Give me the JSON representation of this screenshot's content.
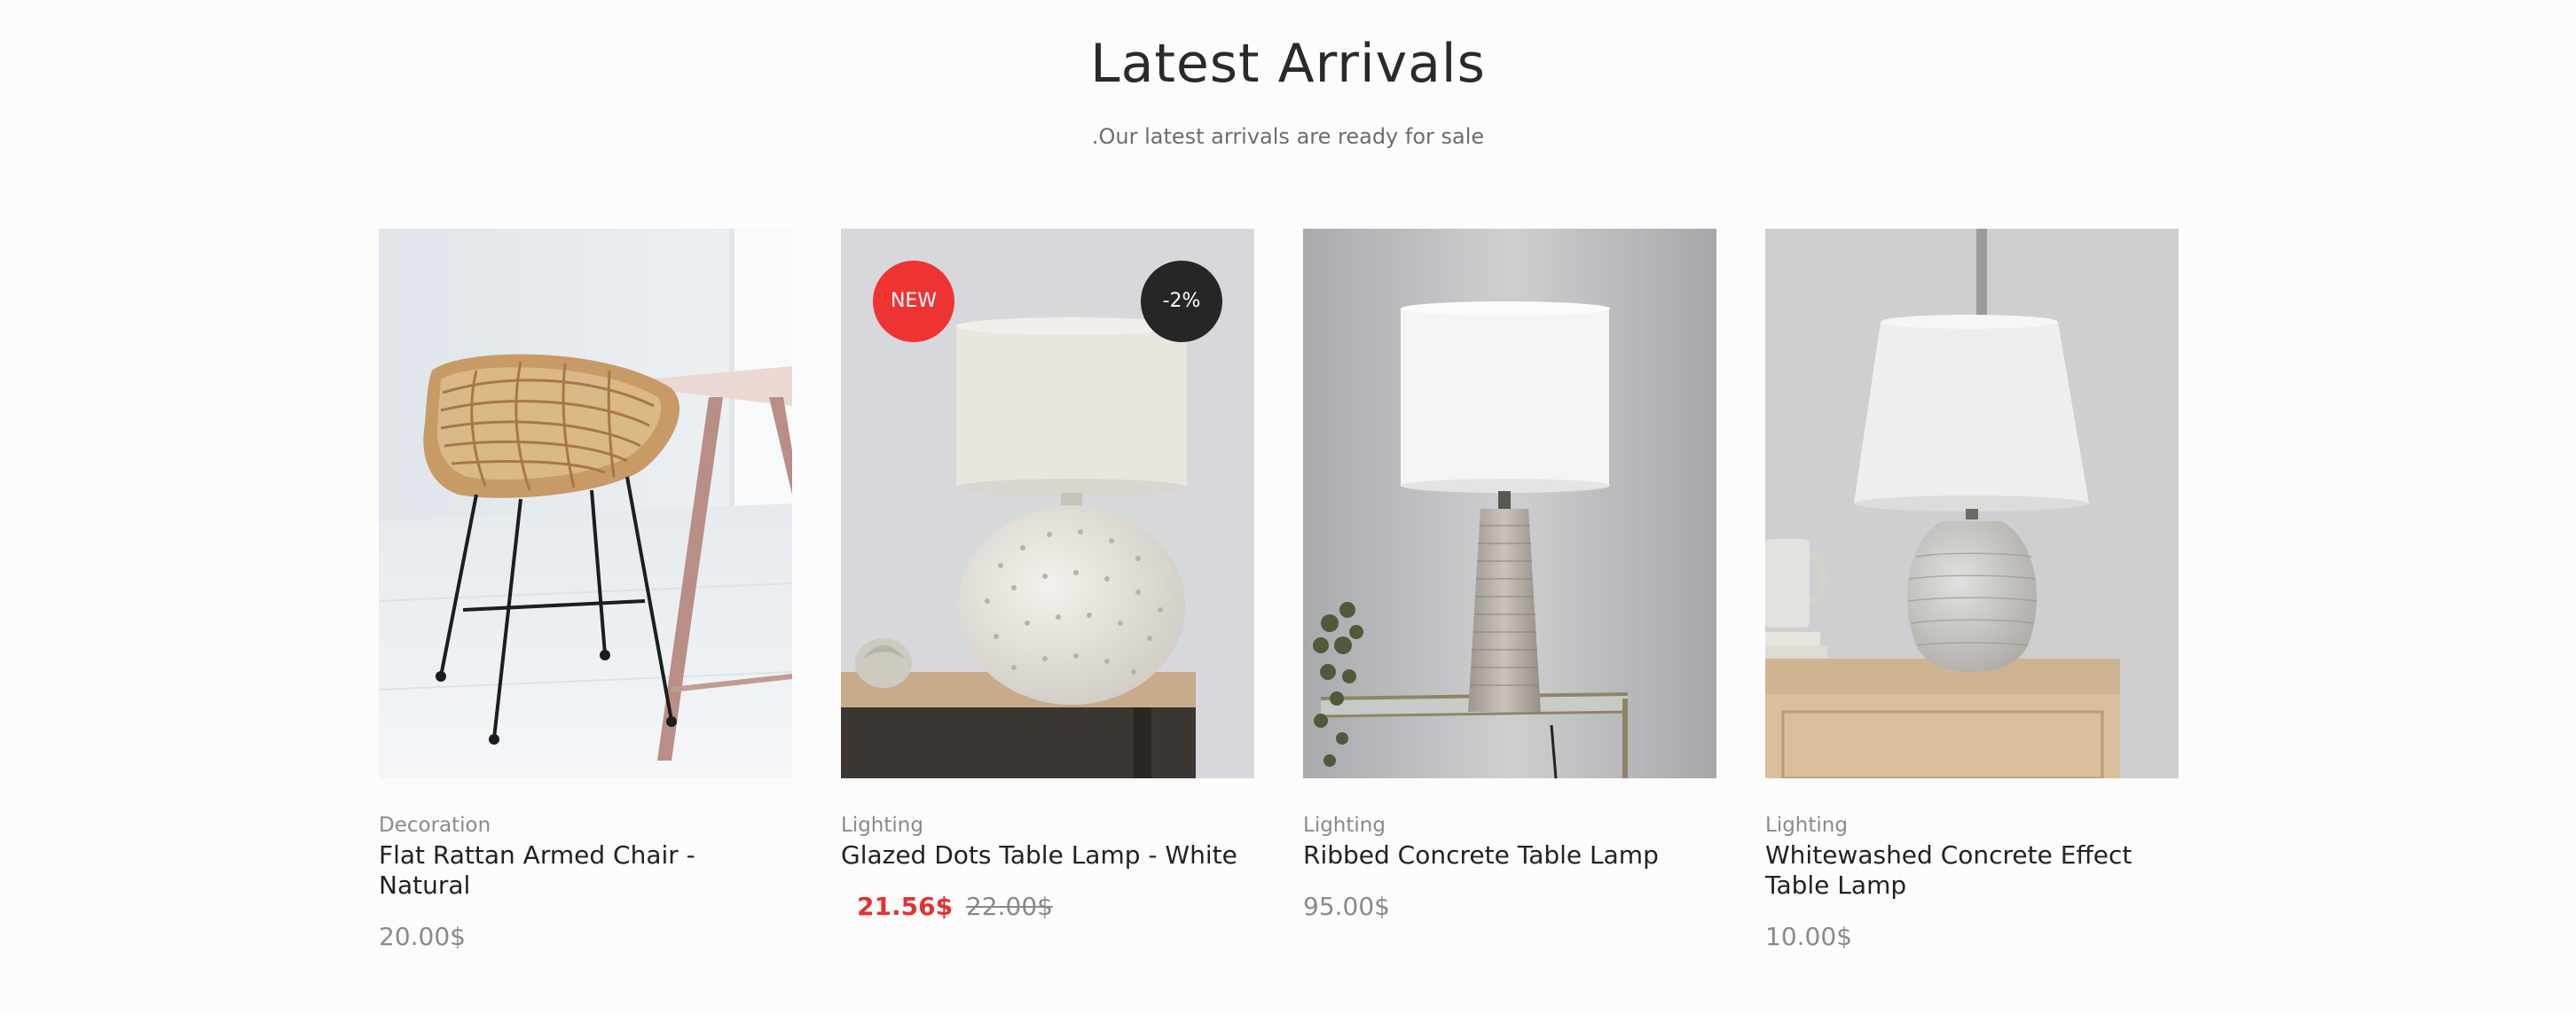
{
  "section": {
    "title": "Latest Arrivals",
    "subtitle": ".Our latest arrivals are ready for sale"
  },
  "products": [
    {
      "category": "Decoration",
      "name": "Flat Rattan Armed Chair - Natural",
      "price": "20.00$"
    },
    {
      "category": "Lighting",
      "name": "Glazed Dots Table Lamp - White",
      "sale_price": "21.56$",
      "regular_price": "22.00$",
      "badge_new": "NEW",
      "badge_discount": "-2%"
    },
    {
      "category": "Lighting",
      "name": "Ribbed Concrete Table Lamp",
      "price": "95.00$"
    },
    {
      "category": "Lighting",
      "name": "Whitewashed Concrete Effect Table Lamp",
      "price": "10.00$"
    }
  ],
  "colors": {
    "sale_accent": "#ee3333",
    "badge_dark": "#262626",
    "muted_text": "#8a8a8a"
  }
}
